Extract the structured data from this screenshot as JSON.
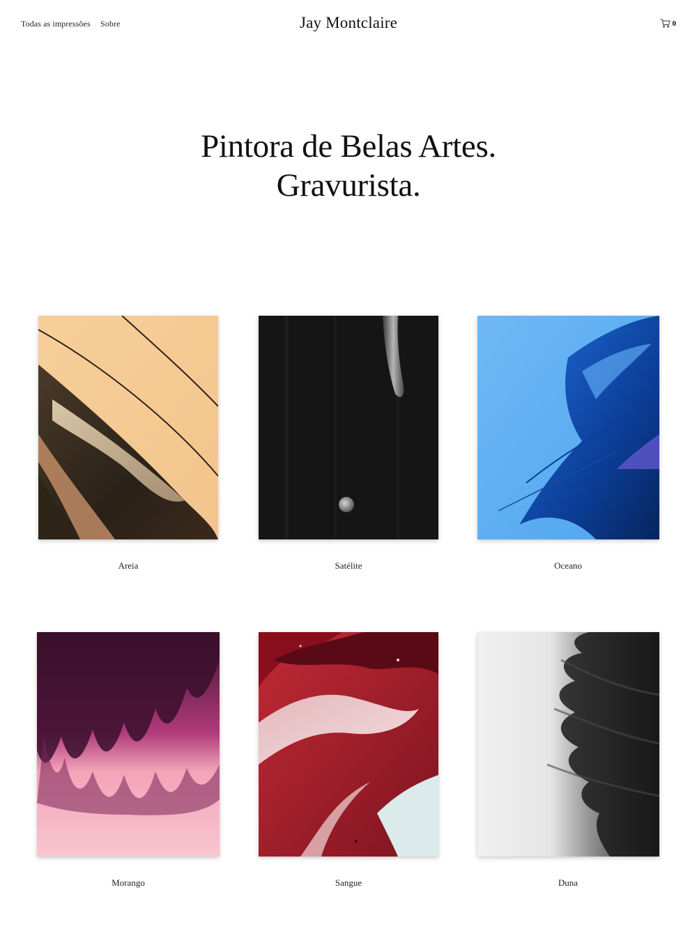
{
  "header": {
    "nav": [
      {
        "label": "Todas as impressões"
      },
      {
        "label": "Sobre"
      }
    ],
    "site_title": "Jay Montclaire",
    "cart": {
      "icon": "cart-icon",
      "count": "0"
    }
  },
  "hero": {
    "line1": "Pintora de Belas Artes.",
    "line2": "Gravurista."
  },
  "prints": [
    {
      "title": "Areia"
    },
    {
      "title": "Satélite"
    },
    {
      "title": "Oceano"
    },
    {
      "title": "Morango"
    },
    {
      "title": "Sangue"
    },
    {
      "title": "Duna"
    }
  ]
}
